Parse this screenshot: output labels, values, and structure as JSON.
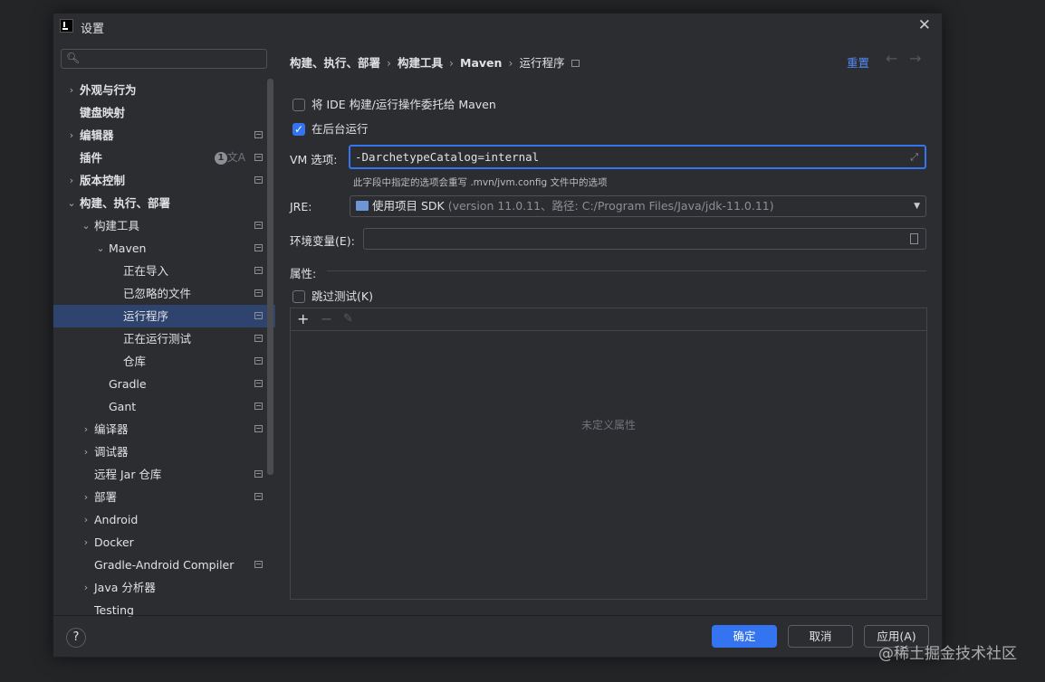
{
  "window": {
    "title": "设置"
  },
  "sidebar": {
    "search_placeholder": "",
    "items": [
      {
        "label": "外观与行为",
        "chevron": "›",
        "bold": true
      },
      {
        "label": "键盘映射",
        "chevron": "",
        "bold": true
      },
      {
        "label": "编辑器",
        "chevron": "›",
        "bold": true
      },
      {
        "label": "插件",
        "chevron": "",
        "bold": true,
        "badge": "1"
      },
      {
        "label": "版本控制",
        "chevron": "›",
        "bold": true
      },
      {
        "label": "构建、执行、部署",
        "chevron": "⌄",
        "bold": true
      },
      {
        "label": "构建工具",
        "chevron": "⌄"
      },
      {
        "label": "Maven",
        "chevron": "⌄"
      },
      {
        "label": "正在导入",
        "chevron": ""
      },
      {
        "label": "已忽略的文件",
        "chevron": ""
      },
      {
        "label": "运行程序",
        "chevron": "",
        "selected": true
      },
      {
        "label": "正在运行测试",
        "chevron": ""
      },
      {
        "label": "仓库",
        "chevron": ""
      },
      {
        "label": "Gradle",
        "chevron": ""
      },
      {
        "label": "Gant",
        "chevron": ""
      },
      {
        "label": "编译器",
        "chevron": "›"
      },
      {
        "label": "调试器",
        "chevron": "›"
      },
      {
        "label": "远程 Jar 仓库",
        "chevron": ""
      },
      {
        "label": "部署",
        "chevron": "›"
      },
      {
        "label": "Android",
        "chevron": "›"
      },
      {
        "label": "Docker",
        "chevron": "›"
      },
      {
        "label": "Gradle-Android Compiler",
        "chevron": ""
      },
      {
        "label": "Java 分析器",
        "chevron": "›"
      },
      {
        "label": "Testing",
        "chevron": ""
      }
    ]
  },
  "breadcrumb": {
    "items": [
      "构建、执行、部署",
      "构建工具",
      "Maven",
      "运行程序"
    ],
    "separator": "›"
  },
  "header": {
    "reset_label": "重置",
    "back_icon": "←",
    "forward_icon": "→"
  },
  "form": {
    "delegate_label": "将 IDE 构建/运行操作委托给 Maven",
    "delegate_checked": false,
    "background_label": "在后台运行",
    "background_checked": true,
    "vm_label": "VM 选项:",
    "vm_value": "-DarchetypeCatalog=internal",
    "vm_hint": "此字段中指定的选项会重写 .mvn/jvm.config 文件中的选项",
    "jre_label": "JRE:",
    "jre_value": "使用项目 SDK",
    "jre_detail": " (version 11.0.11、路径: C:/Program Files/Java/jdk-11.0.11)",
    "env_label": "环境变量(E):",
    "env_value": "",
    "properties_label": "属性:",
    "skip_tests_label": "跳过测试(K)",
    "skip_tests_checked": false,
    "properties_empty": "未定义属性",
    "toolbar": {
      "add": "+",
      "remove": "−",
      "edit": "✎"
    }
  },
  "footer": {
    "help_label": "?",
    "ok_label": "确定",
    "cancel_label": "取消",
    "apply_label": "应用(A)"
  },
  "watermark": "@稀土掘金技术社区",
  "colors": {
    "accent": "#3574f0",
    "selection": "#2e436e",
    "link": "#548af7",
    "background": "#2b2d30"
  }
}
